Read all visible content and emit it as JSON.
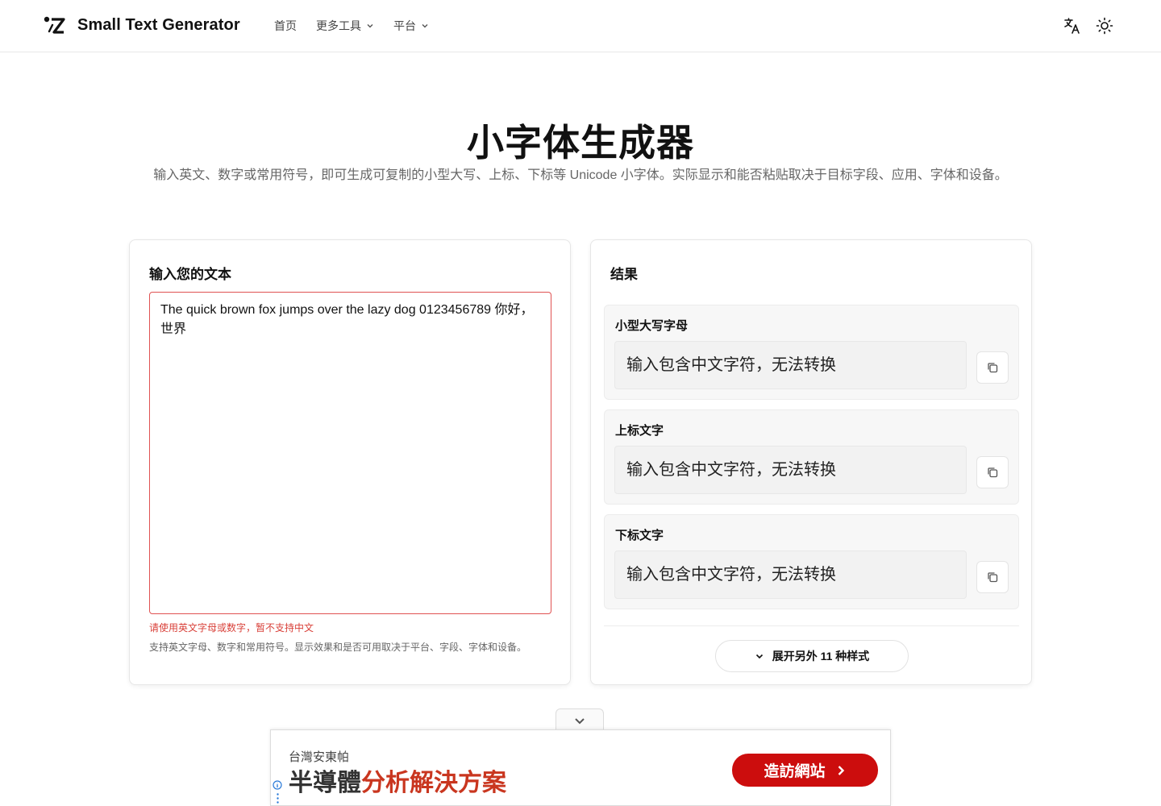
{
  "header": {
    "brand": "Small Text Generator",
    "nav": [
      {
        "label": "首页",
        "has_dropdown": false
      },
      {
        "label": "更多工具",
        "has_dropdown": true
      },
      {
        "label": "平台",
        "has_dropdown": true
      }
    ],
    "icons": [
      "translate-icon",
      "sun-icon"
    ]
  },
  "hero": {
    "title": "小字体生成器",
    "subtitle": "输入英文、数字或常用符号，即可生成可复制的小型大写、上标、下标等 Unicode 小字体。实际显示和能否粘贴取决于目标字段、应用、字体和设备。"
  },
  "input_card": {
    "title": "输入您的文本",
    "value": "The quick brown fox jumps over the lazy dog 0123456789 你好，世界",
    "error": "请使用英文字母或数字，暂不支持中文",
    "hint": "支持英文字母、数字和常用符号。显示效果和是否可用取决于平台、字段、字体和设备。"
  },
  "results_card": {
    "title": "结果",
    "items": [
      {
        "label": "小型大写字母",
        "output": "输入包含中文字符，无法转换"
      },
      {
        "label": "上标文字",
        "output": "输入包含中文字符，无法转换"
      },
      {
        "label": "下标文字",
        "output": "输入包含中文字符，无法转换"
      }
    ],
    "expand_label": "展开另外 11 种样式"
  },
  "ad": {
    "small_text": "台灣安東帕",
    "headline_part1": "半導體",
    "headline_part2": "分析解決方案",
    "cta": "造訪網站"
  },
  "colors": {
    "error_red": "#d9413a",
    "ad_red": "#cc0d0d",
    "ad_headline_red": "#c9361f"
  }
}
